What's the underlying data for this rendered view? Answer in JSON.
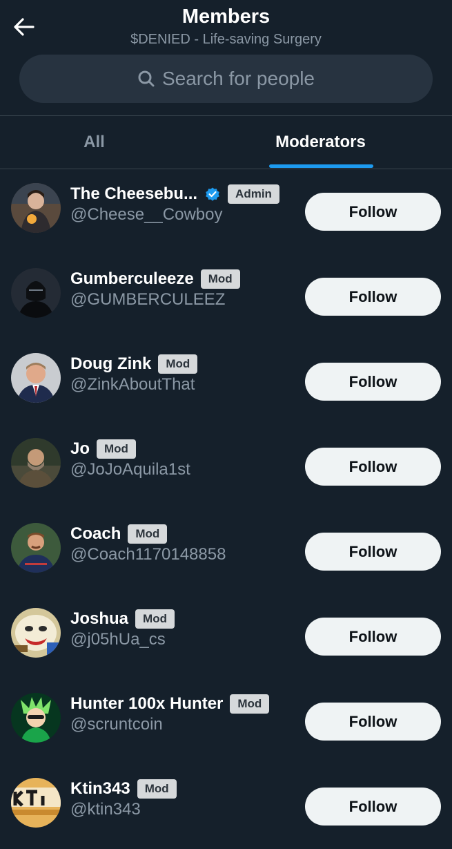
{
  "header": {
    "title": "Members",
    "subtitle": "$DENIED - Life-saving Surgery",
    "back_icon": "arrow-left-icon"
  },
  "search": {
    "placeholder": "Search for people",
    "icon": "search-icon"
  },
  "tabs": [
    {
      "label": "All",
      "selected": false
    },
    {
      "label": "Moderators",
      "selected": true
    }
  ],
  "colors": {
    "background": "#15202b",
    "accent": "#1d9bf0",
    "secondary_text": "#8b98a5",
    "button_bg": "#eff3f4"
  },
  "members": [
    {
      "name": "The Cheesebu...",
      "handle": "@Cheese__Cowboy",
      "verified": true,
      "role": "Admin",
      "button": "Follow"
    },
    {
      "name": "Gumberculeeze",
      "handle": "@GUMBERCULEEZ",
      "verified": false,
      "role": "Mod",
      "button": "Follow"
    },
    {
      "name": "Doug Zink",
      "handle": "@ZinkAboutThat",
      "verified": false,
      "role": "Mod",
      "button": "Follow"
    },
    {
      "name": "Jo",
      "handle": "@JoJoAquila1st",
      "verified": false,
      "role": "Mod",
      "button": "Follow"
    },
    {
      "name": "Coach",
      "handle": "@Coach1170148858",
      "verified": false,
      "role": "Mod",
      "button": "Follow"
    },
    {
      "name": "Joshua",
      "handle": "@j05hUa_cs",
      "verified": false,
      "role": "Mod",
      "button": "Follow"
    },
    {
      "name": "Hunter 100x Hunter",
      "handle": "@scruntcoin",
      "verified": false,
      "role": "Mod",
      "button": "Follow"
    },
    {
      "name": "Ktin343",
      "handle": "@ktin343",
      "verified": false,
      "role": "Mod",
      "button": "Follow"
    }
  ]
}
